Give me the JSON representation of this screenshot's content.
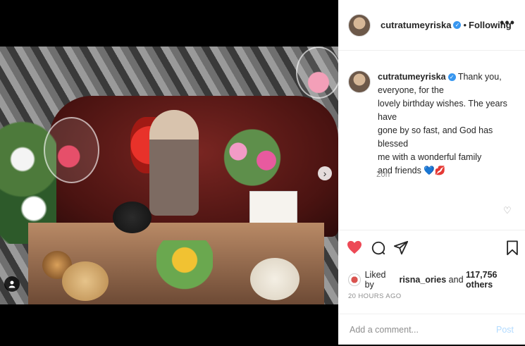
{
  "header": {
    "username": "cutratumeyriska",
    "separator": "•",
    "follow_status": "Following",
    "more_label": "•••"
  },
  "caption": {
    "username": "cutratumeyriska",
    "lines": [
      "Thank you,",
      "everyone, for the",
      "lovely birthday wishes. The years have",
      "gone by so fast, and God has blessed",
      "me with a wonderful family",
      "and friends 💙💋"
    ],
    "relative_time": "20h"
  },
  "likes": {
    "prefix": "Liked by",
    "user": "risna_ories",
    "connector": "and",
    "count": "117,756 others"
  },
  "post_time": "20 HOURS AGO",
  "comment": {
    "placeholder": "Add a comment...",
    "post_label": "Post"
  },
  "icons": {
    "like": "heart-icon",
    "comment": "comment-icon",
    "share": "share-icon",
    "save": "bookmark-icon",
    "next": "chevron-right-icon",
    "verified": "verified-badge-icon"
  },
  "colors": {
    "like": "#ed4956",
    "link": "#3897f0",
    "post_disabled": "#b3dbff"
  }
}
